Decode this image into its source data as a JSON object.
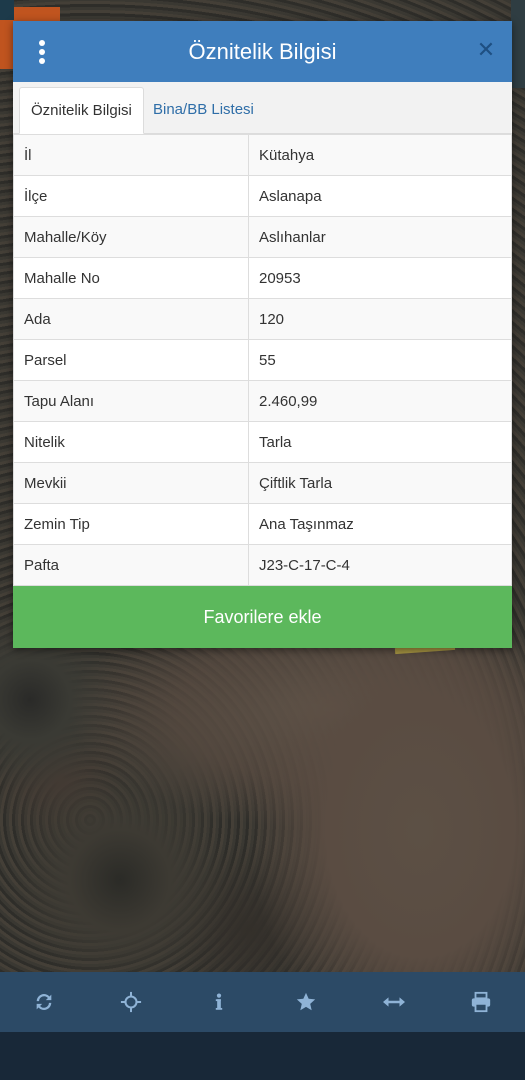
{
  "dialog": {
    "title": "Öznitelik Bilgisi",
    "menu_icon": "vertical-ellipsis-icon",
    "close_icon": "close-icon",
    "tabs": [
      {
        "label": "Öznitelik Bilgisi",
        "active": true
      },
      {
        "label": "Bina/BB Listesi",
        "active": false
      }
    ],
    "attributes": [
      {
        "key": "İl",
        "value": "Kütahya"
      },
      {
        "key": "İlçe",
        "value": "Aslanapa"
      },
      {
        "key": "Mahalle/Köy",
        "value": "Aslıhanlar"
      },
      {
        "key": "Mahalle No",
        "value": "20953"
      },
      {
        "key": "Ada",
        "value": "120"
      },
      {
        "key": "Parsel",
        "value": "55"
      },
      {
        "key": "Tapu Alanı",
        "value": "2.460,99"
      },
      {
        "key": "Nitelik",
        "value": "Tarla"
      },
      {
        "key": "Mevkii",
        "value": "Çiftlik Tarla"
      },
      {
        "key": "Zemin Tip",
        "value": "Ana Taşınmaz"
      },
      {
        "key": "Pafta",
        "value": "J23-C-17-C-4"
      }
    ],
    "favorite_button": "Favorilere ekle"
  },
  "toolbar": {
    "icons": [
      "refresh-icon",
      "locate-crosshair-icon",
      "info-icon",
      "star-icon",
      "measure-arrows-icon",
      "print-icon"
    ]
  },
  "colors": {
    "header": "#3f7ebd",
    "favorite_button": "#5cb85c",
    "toolbar": "#2c4a66",
    "toolbar_icon": "#8fb3d6"
  }
}
